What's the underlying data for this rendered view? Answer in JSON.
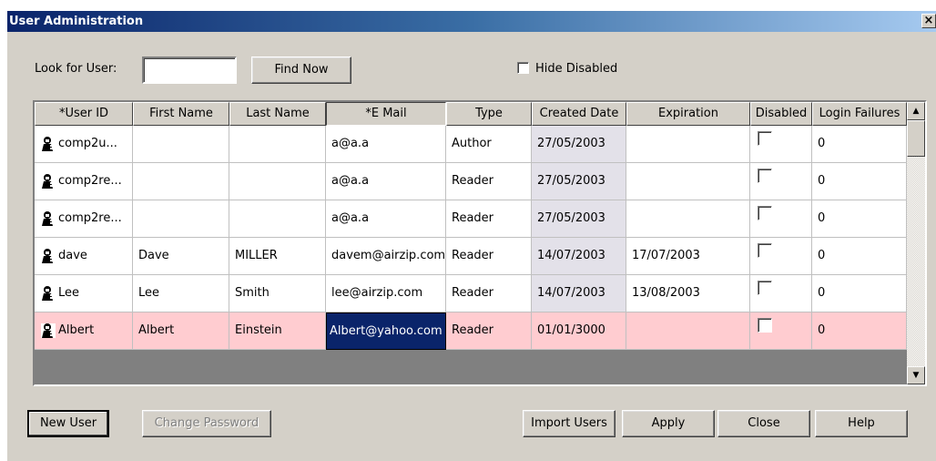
{
  "window": {
    "title": "User Administration",
    "close_glyph": "×"
  },
  "search": {
    "label": "Look for User:",
    "value": "",
    "find_label": "Find Now"
  },
  "hide_disabled": {
    "label": "Hide Disabled",
    "checked": false
  },
  "grid": {
    "columns": [
      "*User ID",
      "First Name",
      "Last Name",
      "*E Mail",
      "Type",
      "Created Date",
      "Expiration",
      "Disabled",
      "Login Failures"
    ],
    "rows": [
      {
        "user_id": "comp2u...",
        "first": "",
        "last": "",
        "email": "a@a.a",
        "type": "Author",
        "created": "27/05/2003",
        "expiration": "",
        "disabled": false,
        "failures": "0"
      },
      {
        "user_id": "comp2re...",
        "first": "",
        "last": "",
        "email": "a@a.a",
        "type": "Reader",
        "created": "27/05/2003",
        "expiration": "",
        "disabled": false,
        "failures": "0"
      },
      {
        "user_id": "comp2re...",
        "first": "",
        "last": "",
        "email": "a@a.a",
        "type": "Reader",
        "created": "27/05/2003",
        "expiration": "",
        "disabled": false,
        "failures": "0"
      },
      {
        "user_id": "dave",
        "first": "Dave",
        "last": "MILLER",
        "email": "davem@airzip.com",
        "type": "Reader",
        "created": "14/07/2003",
        "expiration": "17/07/2003",
        "disabled": false,
        "failures": "0"
      },
      {
        "user_id": "Lee",
        "first": "Lee",
        "last": "Smith",
        "email": "lee@airzip.com",
        "type": "Reader",
        "created": "14/07/2003",
        "expiration": "13/08/2003",
        "disabled": false,
        "failures": "0"
      },
      {
        "user_id": "Albert",
        "first": "Albert",
        "last": "Einstein",
        "email": "Albert@yahoo.com",
        "type": "Reader",
        "created": "01/01/3000",
        "expiration": "",
        "disabled": false,
        "failures": "0"
      }
    ],
    "scroll_up": "▲",
    "scroll_down": "▼"
  },
  "buttons": {
    "new_user": "New User",
    "change_password": "Change Password",
    "import_users": "Import Users",
    "apply": "Apply",
    "close": "Close",
    "help": "Help"
  },
  "colors": {
    "title_start": "#0a246a",
    "title_end": "#a6caf0",
    "highlight_row": "#ffccd0",
    "selection": "#0a246a",
    "face": "#d4d0c8"
  }
}
